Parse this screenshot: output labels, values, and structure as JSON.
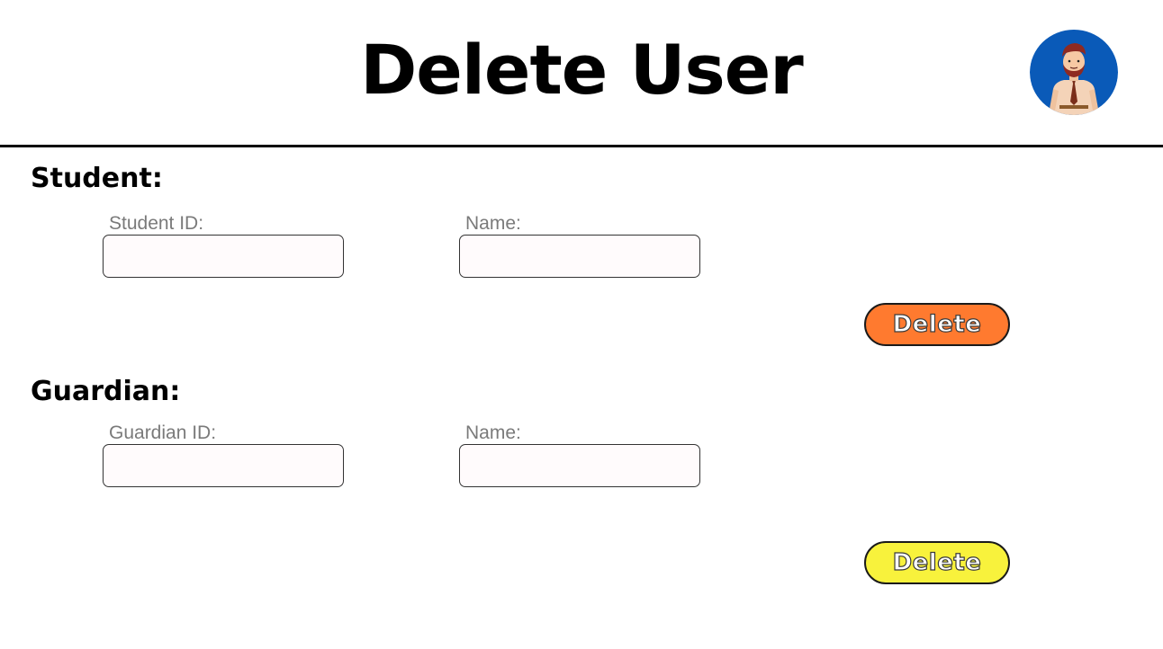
{
  "header": {
    "title": "Delete User"
  },
  "student": {
    "heading": "Student:",
    "id_label": "Student ID:",
    "id_value": "",
    "name_label": "Name:",
    "name_value": "",
    "delete_label": "Delete",
    "delete_color": "#FF7A2F"
  },
  "guardian": {
    "heading": "Guardian:",
    "id_label": "Guardian ID:",
    "id_value": "",
    "name_label": "Name:",
    "name_value": "",
    "delete_label": "Delete",
    "delete_color": "#F8F23C"
  },
  "colors": {
    "avatar_bg": "#0A5AB8",
    "divider": "#000000"
  },
  "icons": {
    "avatar": "user-avatar-icon"
  }
}
